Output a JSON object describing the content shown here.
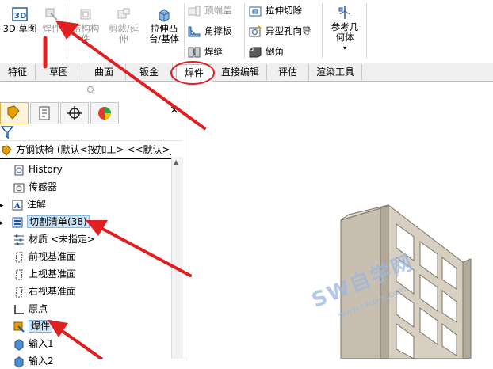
{
  "toolbar": {
    "sketch3d": "3D 草图",
    "weldment": "焊件",
    "structure": "结构构件",
    "trim": "剪裁/延伸",
    "extrude_boss": "拉伸凸台/基体",
    "end_cap": "顶端盖",
    "gusset": "角撑板",
    "weld_bead": "焊缝",
    "extruded_cut": "拉伸切除",
    "hole_wizard": "异型孔向导",
    "chamfer": "倒角",
    "ref_geometry": "参考几何体"
  },
  "tabs": [
    {
      "label": "特征",
      "active": false
    },
    {
      "label": "草图",
      "active": false
    },
    {
      "label": "曲面",
      "active": false
    },
    {
      "label": "钣金",
      "active": false
    },
    {
      "label": "焊件",
      "active": true
    },
    {
      "label": "直接编辑",
      "active": false
    },
    {
      "label": "评估",
      "active": false
    },
    {
      "label": "渲染工具",
      "active": false
    }
  ],
  "tree": {
    "root": "方钢铁椅 (默认<按加工> <<默认>_显",
    "items": [
      {
        "label": "History",
        "icon": "history-icon"
      },
      {
        "label": "传感器",
        "icon": "sensor-icon"
      },
      {
        "label": "注解",
        "icon": "annotation-icon"
      },
      {
        "label": "切割清单(38)",
        "icon": "cut-list-icon"
      },
      {
        "label": "材质 <未指定>",
        "icon": "material-icon"
      },
      {
        "label": "前视基准面",
        "icon": "plane-icon"
      },
      {
        "label": "上视基准面",
        "icon": "plane-icon"
      },
      {
        "label": "右视基准面",
        "icon": "plane-icon"
      },
      {
        "label": "原点",
        "icon": "origin-icon"
      },
      {
        "label": "焊件",
        "icon": "weldment-icon"
      },
      {
        "label": "输入1",
        "icon": "import-icon"
      },
      {
        "label": "输入2",
        "icon": "import-icon"
      }
    ]
  },
  "watermark": {
    "main": "SW自学网",
    "sub": "www.swzxw.com"
  },
  "colors": {
    "arrow": "#e02020",
    "frame": "#c9bfb0",
    "highlight": "#cfe3f6"
  }
}
